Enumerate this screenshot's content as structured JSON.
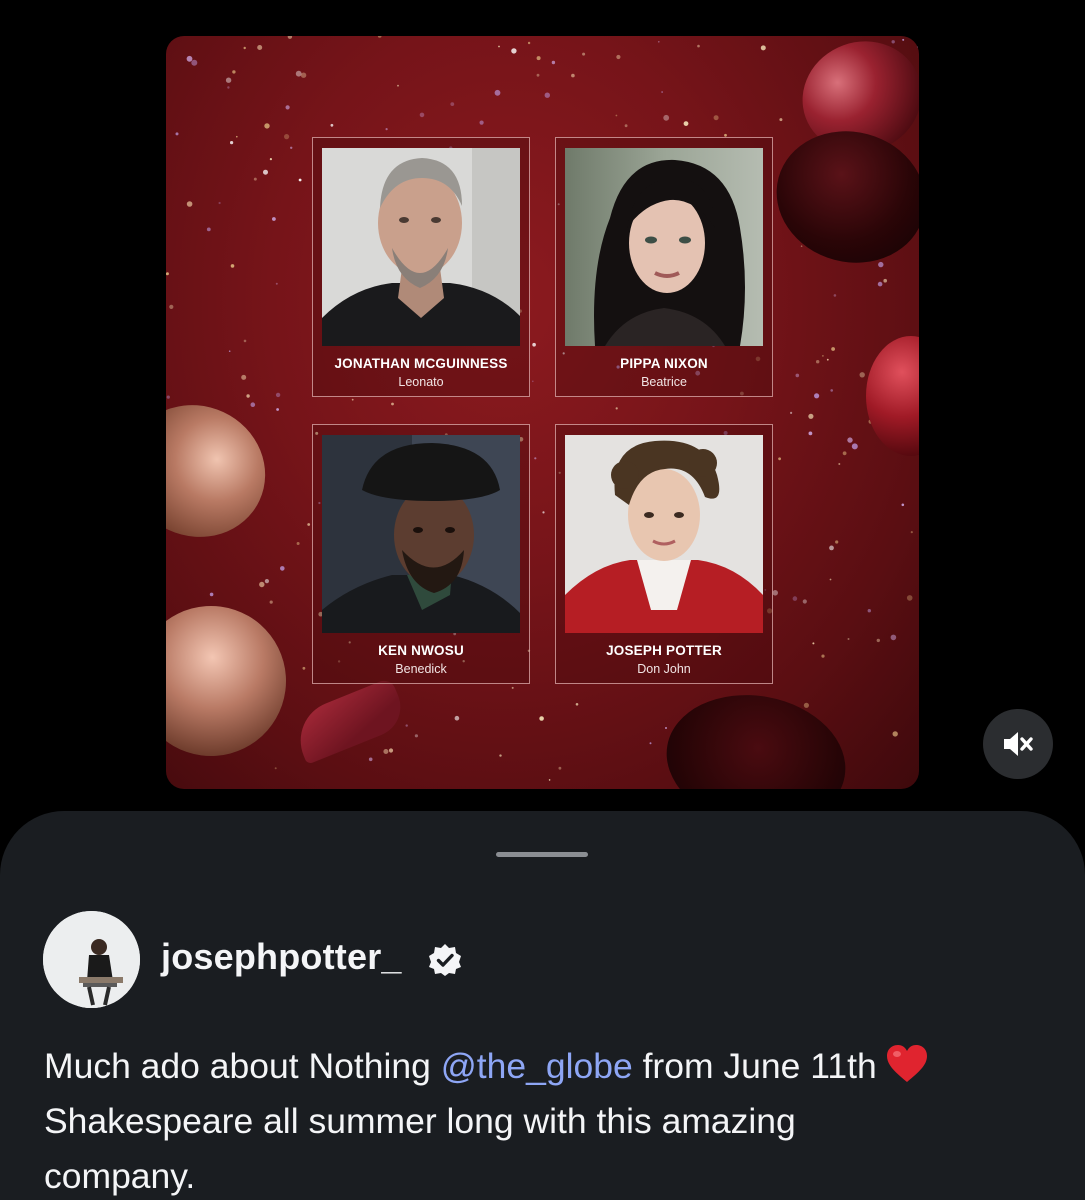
{
  "post": {
    "media": {
      "cast": [
        {
          "name": "JONATHAN MCGUINNESS",
          "role": "Leonato"
        },
        {
          "name": "PIPPA NIXON",
          "role": "Beatrice"
        },
        {
          "name": "KEN NWOSU",
          "role": "Benedick"
        },
        {
          "name": "JOSEPH POTTER",
          "role": "Don John"
        }
      ],
      "mute_icon": "speaker-muted-icon"
    },
    "author": {
      "username": "josephpotter_",
      "verified": true,
      "verified_icon": "verified-badge-icon"
    },
    "caption": {
      "line1_text": "Much ado about Nothing ",
      "mention": "@the_globe",
      "line1_tail": " from June 11th",
      "emoji_icon": "red-heart-icon",
      "line2": "Shakespeare all summer long with this amazing",
      "line3": "company."
    }
  },
  "colors": {
    "background": "#000000",
    "sheet": "#1a1d21",
    "mention": "#8ea6f5",
    "poster_red": "#761419",
    "heart": "#e0242f"
  }
}
